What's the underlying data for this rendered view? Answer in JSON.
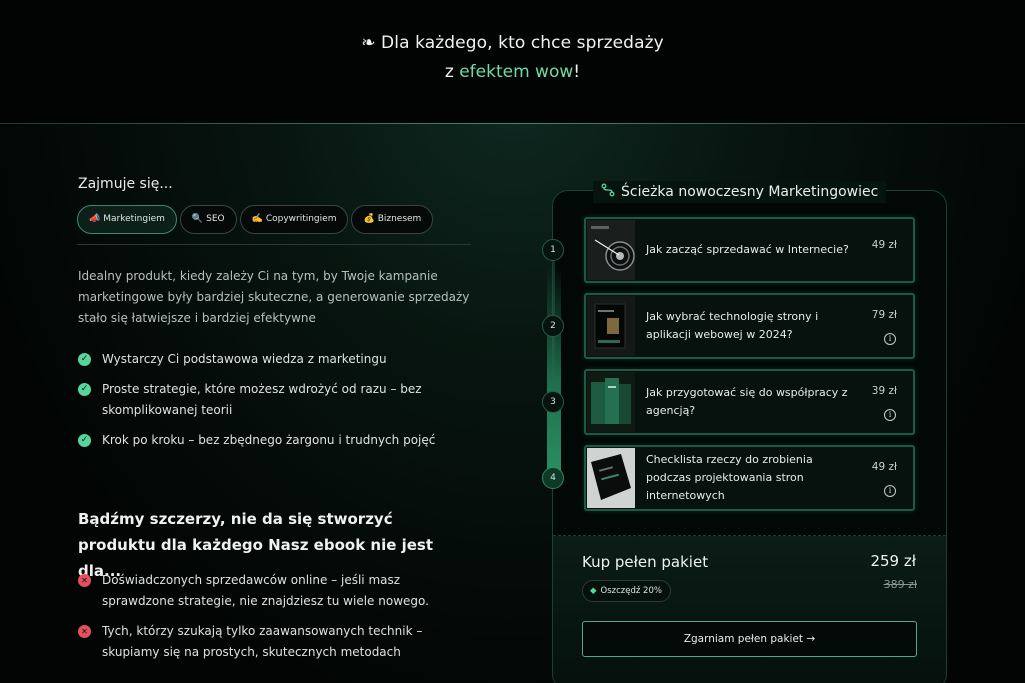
{
  "hero": {
    "line1": "❧ Dla każdego, kto chce sprzedaży",
    "line2_prefix": "z ",
    "line2_accent": "efektem wow",
    "line2_suffix": "!"
  },
  "intro": {
    "label": "Zajmuje się...",
    "chips": [
      {
        "icon": "📣",
        "label": "Marketingiem",
        "active": true
      },
      {
        "icon": "🔍",
        "label": "SEO",
        "active": false
      },
      {
        "icon": "✍️",
        "label": "Copywritingiem",
        "active": false
      },
      {
        "icon": "💰",
        "label": "Biznesem",
        "active": false
      }
    ],
    "description": "Idealny produkt, kiedy zależy Ci na tym, by Twoje kampanie marketingowe były bardziej skuteczne, a generowanie sprzedaży stało się łatwiejsze i bardziej efektywne",
    "checks": [
      "Wystarczy Ci podstawowa wiedza z marketingu",
      "Proste strategie, które możesz wdrożyć od razu – bez skomplikowanej teorii",
      "Krok po kroku – bez zbędnego żargonu i trudnych pojęć"
    ]
  },
  "not_for": {
    "heading": "Bądźmy szczerzy, nie da się stworzyć produktu dla każdego Nasz ebook nie jest dla...",
    "items": [
      "Doświadczonych sprzedawców online – jeśli masz sprawdzone strategie, nie znajdziesz tu wiele nowego.",
      "Tych, którzy szukają tylko zaawansowanych technik – skupiamy się na prostych, skutecznych metodach"
    ]
  },
  "card": {
    "title": "Ścieżka nowoczesny Marketingowiec",
    "icon": "path-icon",
    "products": [
      {
        "step": "1",
        "title": "Jak zacząć sprzedawać w Internecie?",
        "price": "49 zł",
        "info": false
      },
      {
        "step": "2",
        "title": "Jak wybrać technologię strony i aplikacji webowej w 2024?",
        "price": "79 zł",
        "info": true
      },
      {
        "step": "3",
        "title": "Jak przygotować się do współpracy z agencją?",
        "price": "39 zł",
        "info": true
      },
      {
        "step": "4",
        "title": "Checklista rzeczy do zrobienia podczas projektowania stron internetowych",
        "price": "49 zł",
        "info": true
      }
    ],
    "bundle": {
      "title": "Kup pełen pakiet",
      "price": "259 zł",
      "old_price": "389 zł",
      "save_label": "Oszczędź 20%",
      "cta": "Zgarniam pełen pakiet →"
    }
  },
  "colors": {
    "accent": "#6fdca7",
    "check": "#57d59a",
    "cross": "#e0525f",
    "border": "#1c5a43"
  }
}
